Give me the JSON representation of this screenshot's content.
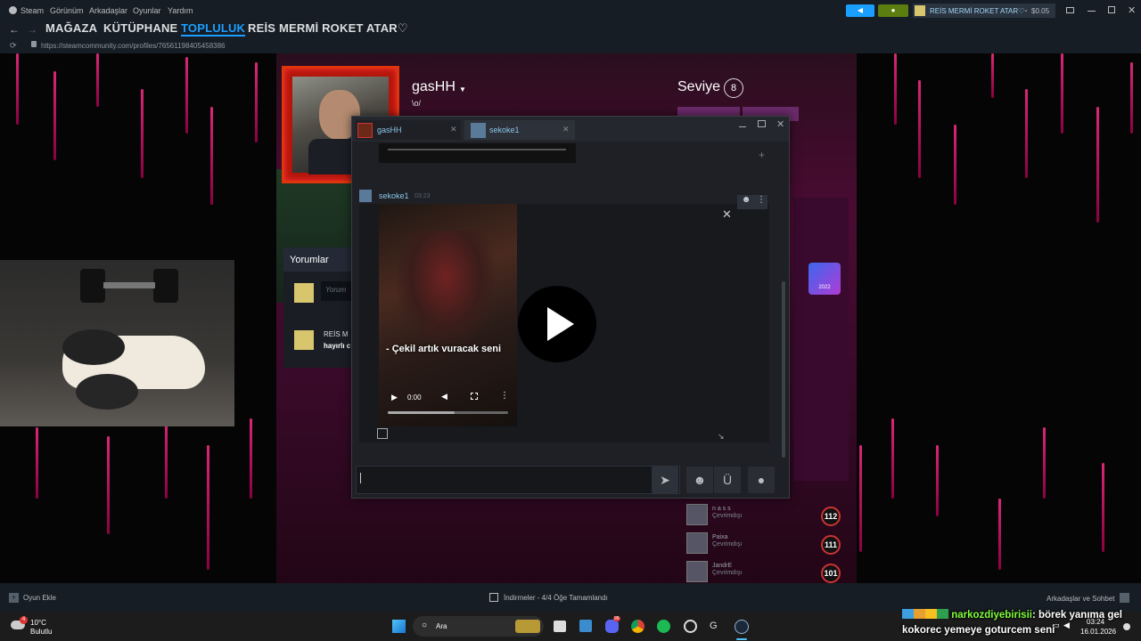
{
  "menubar": {
    "app": "Steam",
    "items": [
      "Görünüm",
      "Arkadaşlar",
      "Oyunlar",
      "Yardım"
    ],
    "account": "REİS MERMİ ROKET ATAR♡",
    "balance": "$0.05"
  },
  "nav": {
    "store": "MAĞAZA",
    "library": "KÜTÜPHANE",
    "community": "TOPLULUK",
    "username": "REİS MERMİ ROKET ATAR♡"
  },
  "url": "https://steamcommunity.com/profiles/76561198405458386",
  "profile": {
    "name": "gasHH",
    "tagline": "\\o/",
    "level_label": "Seviye",
    "level": "8",
    "comments_title": "Yorumlar",
    "comment_placeholder": "Yorum",
    "comment_author": "REİS M",
    "comment_text": "hayırlı c",
    "badge_year": "2022"
  },
  "chat": {
    "tabs": [
      {
        "name": "gasHH"
      },
      {
        "name": "sekoke1"
      }
    ],
    "message_author": "sekoke1",
    "message_time": "03:23",
    "video_caption": "- Çekil artık vuracak seni",
    "video_time": "0:00"
  },
  "friends": [
    {
      "name": "n a s s",
      "status": "Çevrimdışı",
      "level": "112"
    },
    {
      "name": "Paixa",
      "status": "Çevrimdışı",
      "level": "111"
    },
    {
      "name": "JandrE",
      "status": "Çevrimdışı",
      "level": "101"
    }
  ],
  "statusbar": {
    "add_game": "Oyun Ekle",
    "downloads": "İndirmeler - 4/4 Öğe Tamamlandı",
    "friends_chat": "Arkadaşlar ve Sohbet"
  },
  "taskbar": {
    "weather_temp": "10°C",
    "weather_desc": "Bulutlu",
    "weather_badge": "4",
    "search": "Ara",
    "time": "03:24",
    "date": "16.01.2026",
    "discord_badge": "99"
  },
  "overlay": {
    "user": "narkozdiyebirisii",
    "text1": ": börek yanıma gel",
    "text2": "kokorec yemeye goturcem seni"
  },
  "colors": {
    "steam_bg": "#171d25",
    "accent_blue": "#1a9fff",
    "notify_green": "#5c7e10",
    "stripe_pink": "#ff2d8a"
  }
}
